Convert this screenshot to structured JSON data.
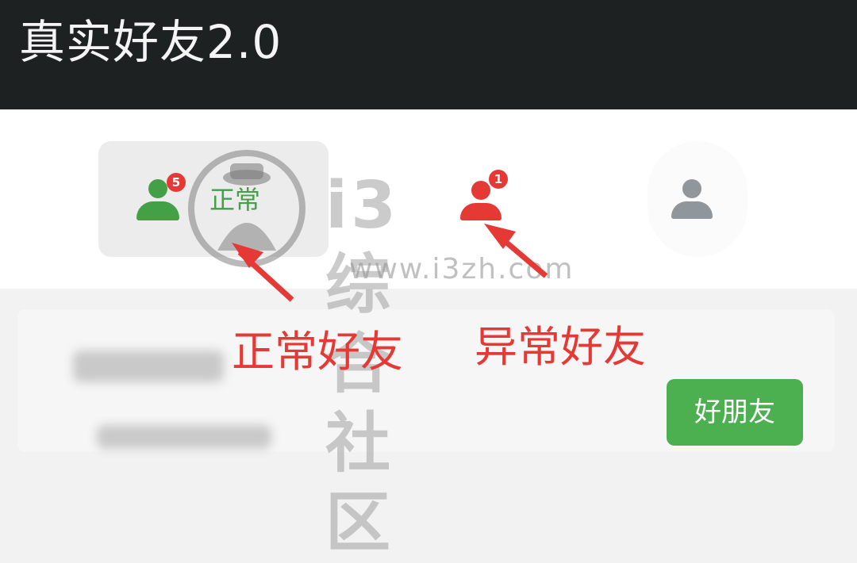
{
  "app": {
    "title": "真实好友2.0"
  },
  "tabs": [
    {
      "label": "正常",
      "badge": "5",
      "color": "#43a047",
      "icon": "person-icon"
    },
    {
      "label": "",
      "badge": "1",
      "color": "#e53935",
      "icon": "person-icon"
    },
    {
      "label": "",
      "badge": "",
      "color": "#8f969c",
      "icon": "person-icon"
    }
  ],
  "friend_card": {
    "tag_label": "好朋友",
    "tag_color": "#4caf50"
  },
  "annotations": {
    "normal": "正常好友",
    "abnormal": "异常好友"
  },
  "watermark": {
    "site": "i3综合社区",
    "url": "www.i3zh.com"
  }
}
